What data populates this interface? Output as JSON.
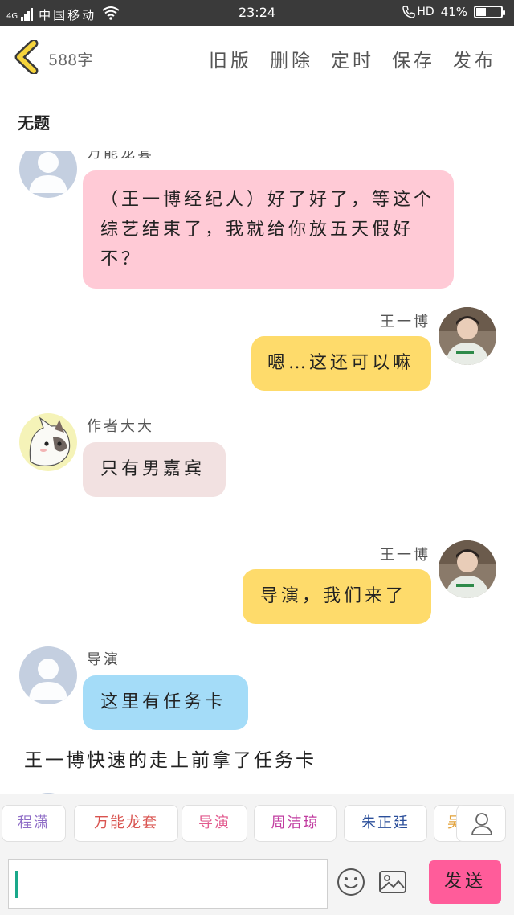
{
  "status_bar": {
    "network": "4G",
    "carrier": "中国移动",
    "time": "23:24",
    "hd_label": "HD",
    "battery": "41%",
    "battery_level": 0.41
  },
  "header": {
    "word_count": "588字",
    "actions": [
      "旧版",
      "删除",
      "定时",
      "保存",
      "发布"
    ]
  },
  "title": "无题",
  "messages": [
    {
      "speaker": "万能龙套",
      "side": "left",
      "avatar": "default-avatar",
      "text": "（王一博经纪人）好了好了，等这个综艺结束了，我就给你放五天假好不？",
      "bubble_color": "#ffcad6"
    },
    {
      "speaker": "王一博",
      "side": "right",
      "avatar": "photo-avatar",
      "text": "嗯…这还可以嘛",
      "bubble_color": "#fedb6b"
    },
    {
      "speaker": "作者大大",
      "side": "left",
      "avatar": "cat-avatar",
      "text": "只有男嘉宾",
      "bubble_color": "#f2e1e1"
    },
    {
      "speaker": "王一博",
      "side": "right",
      "avatar": "photo-avatar",
      "text": "导演，我们来了",
      "bubble_color": "#fedb6b"
    },
    {
      "speaker": "导演",
      "side": "left",
      "avatar": "default-avatar",
      "text": "这里有任务卡",
      "bubble_color": "#a4dcf8"
    }
  ],
  "narration": "王一博快速的走上前拿了任务卡",
  "characters": [
    {
      "name": "程潇",
      "color": "#8e6cc6"
    },
    {
      "name": "万能龙套",
      "color": "#d9534f"
    },
    {
      "name": "导演",
      "color": "#e25a8e"
    },
    {
      "name": "周洁琼",
      "color": "#c13ca0"
    },
    {
      "name": "朱正廷",
      "color": "#2a4e9a"
    },
    {
      "name": "吴",
      "color": "#e2a23b"
    }
  ],
  "input": {
    "value": "",
    "placeholder": "",
    "send_label": "发送"
  },
  "icons": [
    "back-icon",
    "emoji-icon",
    "image-icon",
    "person-icon",
    "wifi-icon",
    "signal-icon",
    "phone-hd-icon",
    "battery-icon"
  ]
}
